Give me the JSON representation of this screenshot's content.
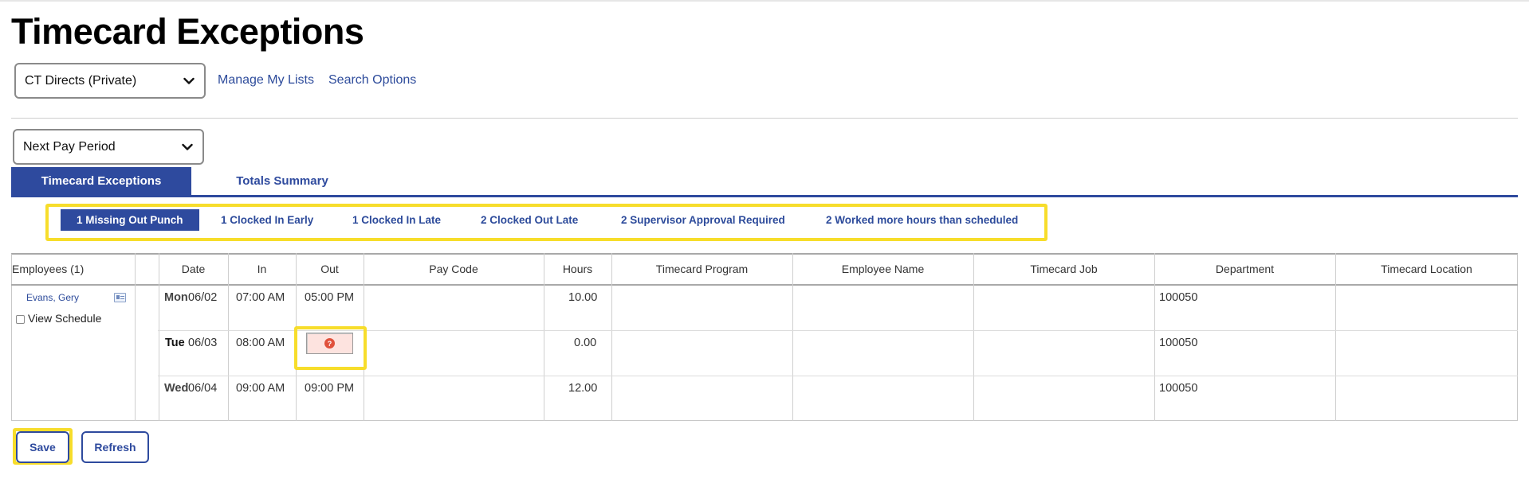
{
  "page": {
    "title": "Timecard Exceptions"
  },
  "filters": {
    "list_select": "CT Directs (Private)",
    "period_select": "Next Pay Period",
    "manage_lists_link": "Manage My Lists",
    "search_options_link": "Search Options"
  },
  "tabs": [
    {
      "label": "Timecard Exceptions",
      "active": true
    },
    {
      "label": "Totals Summary",
      "active": false
    }
  ],
  "exceptions": [
    {
      "label": "1 Missing Out Punch",
      "active": true
    },
    {
      "label": "1 Clocked In Early",
      "active": false
    },
    {
      "label": "1 Clocked In Late",
      "active": false
    },
    {
      "label": "2 Clocked Out Late",
      "active": false
    },
    {
      "label": "2 Supervisor Approval Required",
      "active": false
    },
    {
      "label": "2 Worked more hours than scheduled",
      "active": false
    }
  ],
  "table": {
    "headers": {
      "employees": "Employees (1)",
      "date": "Date",
      "in": "In",
      "out": "Out",
      "pay_code": "Pay Code",
      "hours": "Hours",
      "program": "Timecard Program",
      "employee_name": "Employee Name",
      "job": "Timecard Job",
      "department": "Department",
      "location": "Timecard Location"
    },
    "employee": {
      "name": "Evans, Gery",
      "view_schedule": "View Schedule"
    },
    "rows": [
      {
        "day": "Mon",
        "date": "06/02",
        "in": "07:00 AM",
        "out": "05:00 PM",
        "hours": "10.00",
        "department": "100050"
      },
      {
        "day": "Tue",
        "date": "06/03",
        "in": "08:00 AM",
        "out": "",
        "hours": "0.00",
        "department": "100050"
      },
      {
        "day": "Wed",
        "date": "06/04",
        "in": "09:00 AM",
        "out": "09:00 PM",
        "hours": "12.00",
        "department": "100050"
      }
    ],
    "missing_punch_icon": "?"
  },
  "buttons": {
    "save": "Save",
    "refresh": "Refresh"
  },
  "colors": {
    "accent": "#2e4a9e",
    "highlight": "#f7dd2b",
    "missing_bg": "#fde3df",
    "warning": "#e0513c"
  },
  "icons": {
    "chevron": "chevron-down-icon",
    "card": "employee-card-icon",
    "warning": "question-warning-icon"
  }
}
